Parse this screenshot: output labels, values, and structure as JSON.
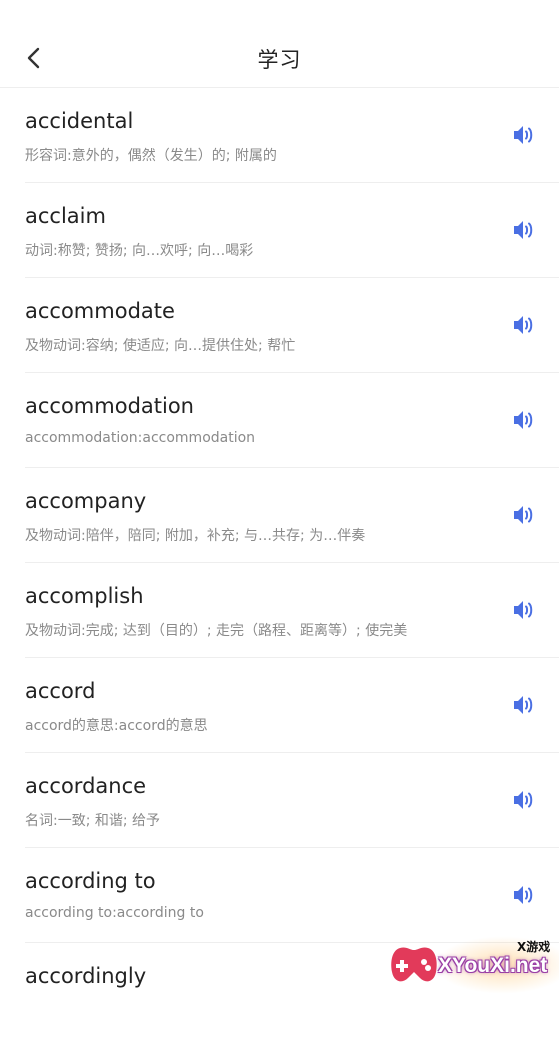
{
  "header": {
    "title": "学习"
  },
  "words": [
    {
      "word": "accidental",
      "definition": "形容词:意外的，偶然（发生）的; 附属的"
    },
    {
      "word": "acclaim",
      "definition": "动词:称赞; 赞扬; 向…欢呼; 向…喝彩"
    },
    {
      "word": "accommodate",
      "definition": "及物动词:容纳; 使适应; 向…提供住处; 帮忙"
    },
    {
      "word": "accommodation",
      "definition": "accommodation:accommodation"
    },
    {
      "word": "accompany",
      "definition": "及物动词:陪伴，陪同; 附加，补充; 与…共存; 为…伴奏"
    },
    {
      "word": "accomplish",
      "definition": "及物动词:完成; 达到（目的）; 走完（路程、距离等）; 使完美"
    },
    {
      "word": "accord",
      "definition": "accord的意思:accord的意思"
    },
    {
      "word": "accordance",
      "definition": "名词:一致; 和谐; 给予"
    },
    {
      "word": "according to",
      "definition": "according to:according to"
    },
    {
      "word": "accordingly",
      "definition": ""
    }
  ],
  "colors": {
    "speaker": "#4a6fe3",
    "divider": "#eeeeee",
    "definition": "#8a8a8a"
  },
  "watermark": {
    "small_text": "X游戏",
    "big_text": "XYouXi.net"
  }
}
